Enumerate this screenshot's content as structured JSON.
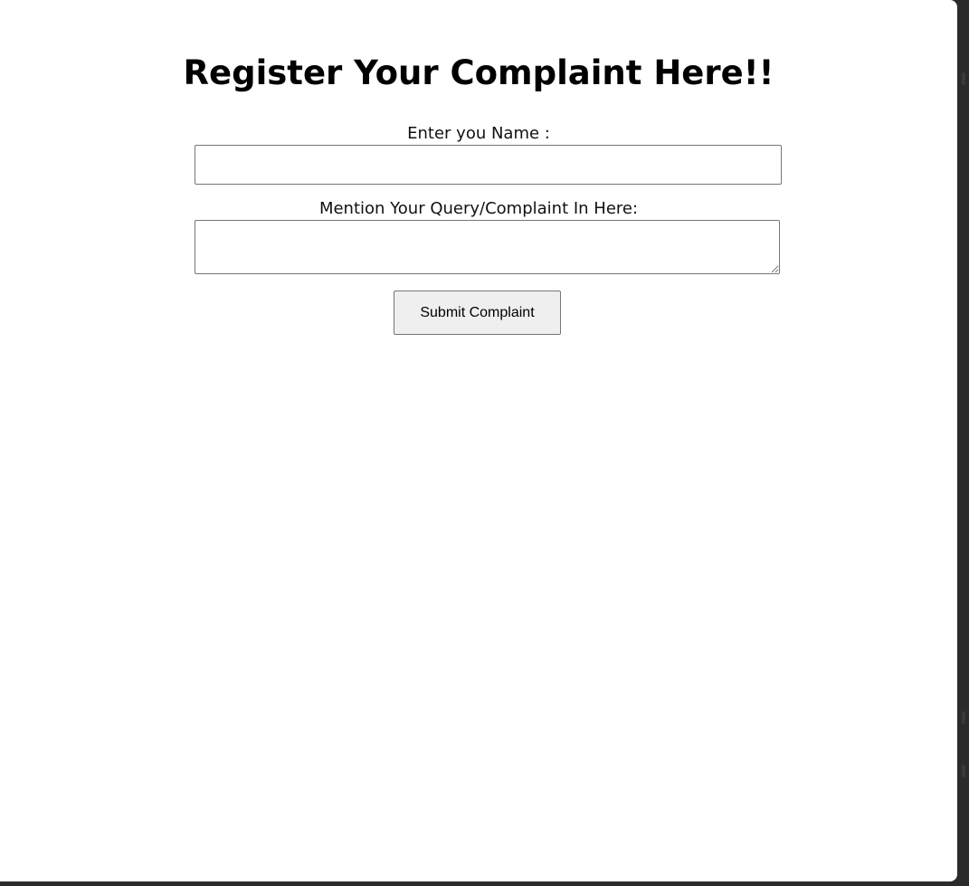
{
  "page": {
    "title": "Register Your Complaint Here!!"
  },
  "form": {
    "name_label": "Enter you Name :",
    "name_value": "",
    "query_label": "Mention Your Query/Complaint In Here:",
    "query_value": "",
    "submit_label": "Submit Complaint"
  },
  "colors": {
    "background": "#ffffff",
    "window_edge": "#2b2b2b",
    "button_bg": "#efefef",
    "input_border": "#767676"
  }
}
